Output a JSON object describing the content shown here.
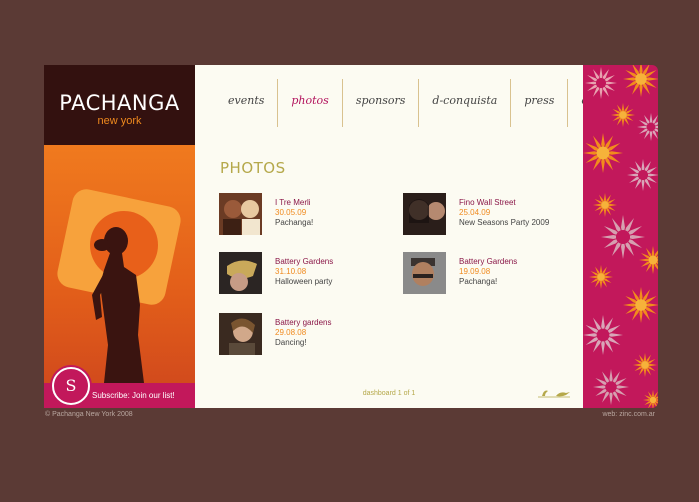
{
  "brand": {
    "name": "PACHANGA",
    "sub": "new york"
  },
  "subscribe": {
    "badge": "S",
    "label": "Subscribe: Join our list!"
  },
  "nav": [
    {
      "label": "events",
      "active": false
    },
    {
      "label": "photos",
      "active": true
    },
    {
      "label": "sponsors",
      "active": false
    },
    {
      "label": "d-conquista",
      "active": false
    },
    {
      "label": "press",
      "active": false
    },
    {
      "label": "contact",
      "active": false
    }
  ],
  "page_title": "PHOTOS",
  "photos": [
    {
      "title": "I Tre Merli",
      "date": "30.05.09",
      "desc": "Pachanga!"
    },
    {
      "title": "Fino Wall Street",
      "date": "25.04.09",
      "desc": "New Seasons Party 2009"
    },
    {
      "title": "Battery Gardens",
      "date": "31.10.08",
      "desc": "Halloween party"
    },
    {
      "title": "Battery Gardens",
      "date": "19.09.08",
      "desc": "Pachanga!"
    },
    {
      "title": "Battery gardens",
      "date": "29.08.08",
      "desc": "Dancing!"
    }
  ],
  "pagination": "dashboard 1 of 1",
  "footer": {
    "copyright": "© Pachanga New York 2008",
    "credit": "web: zinc.com.ar"
  },
  "colors": {
    "background": "#5b3a35",
    "accent": "#c2185b",
    "orange": "#f08a1e",
    "title": "#b5a84a",
    "panel": "#fcfbf2"
  }
}
